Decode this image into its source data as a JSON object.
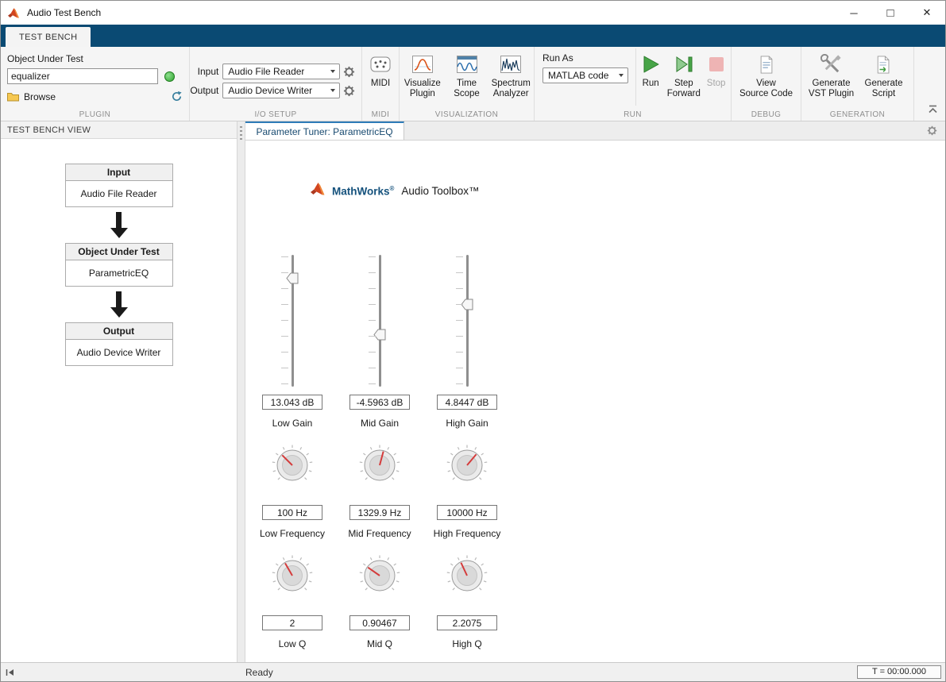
{
  "window": {
    "title": "Audio Test Bench",
    "controls": {
      "minimize": "─",
      "maximize": "□",
      "close": "✕"
    }
  },
  "ribbon": {
    "tab_label": "TEST BENCH",
    "plugin": {
      "object_under_test_label": "Object Under Test",
      "object_value": "equalizer",
      "browse_label": "Browse",
      "section_label": "PLUGIN"
    },
    "io_setup": {
      "input_label": "Input",
      "input_value": "Audio File Reader",
      "output_label": "Output",
      "output_value": "Audio Device Writer",
      "section_label": "I/O SETUP"
    },
    "midi": {
      "button_label": "MIDI",
      "section_label": "MIDI"
    },
    "visualization": {
      "visualize_label": "Visualize\nPlugin",
      "time_scope_label": "Time\nScope",
      "spectrum_label": "Spectrum\nAnalyzer",
      "section_label": "VISUALIZATION"
    },
    "run": {
      "run_as_label": "Run As",
      "run_as_value": "MATLAB code",
      "run_label": "Run",
      "step_label": "Step\nForward",
      "stop_label": "Stop",
      "section_label": "RUN"
    },
    "debug": {
      "view_source_label": "View\nSource Code",
      "section_label": "DEBUG"
    },
    "generation": {
      "vst_label": "Generate\nVST Plugin",
      "script_label": "Generate\nScript",
      "section_label": "GENERATION"
    }
  },
  "left_panel": {
    "header": "TEST BENCH VIEW",
    "diagram": [
      {
        "title": "Input",
        "value": "Audio File Reader"
      },
      {
        "title": "Object Under Test",
        "value": "ParametricEQ"
      },
      {
        "title": "Output",
        "value": "Audio Device Writer"
      }
    ]
  },
  "main": {
    "tab_label": "Parameter Tuner: ParametricEQ",
    "brand": {
      "name": "MathWorks",
      "reg": "®",
      "product": "Audio Toolbox™"
    },
    "sliders": [
      {
        "label": "Low Gain",
        "value": "13.043 dB",
        "fraction": 0.826
      },
      {
        "label": "Mid Gain",
        "value": "-4.5963 dB",
        "fraction": 0.385
      },
      {
        "label": "High Gain",
        "value": "4.8447 dB",
        "fraction": 0.621
      }
    ],
    "freq_knobs": [
      {
        "label": "Low Frequency",
        "value": "100 Hz",
        "needle_angle": -45
      },
      {
        "label": "Mid Frequency",
        "value": "1329.9 Hz",
        "needle_angle": 15
      },
      {
        "label": "High Frequency",
        "value": "10000 Hz",
        "needle_angle": 40
      }
    ],
    "q_knobs": [
      {
        "label": "Low Q",
        "value": "2",
        "needle_angle": -30
      },
      {
        "label": "Mid Q",
        "value": "0.90467",
        "needle_angle": -55
      },
      {
        "label": "High Q",
        "value": "2.2075",
        "needle_angle": -25
      }
    ]
  },
  "status_bar": {
    "ready": "Ready",
    "timer": "T = 00:00.000"
  }
}
